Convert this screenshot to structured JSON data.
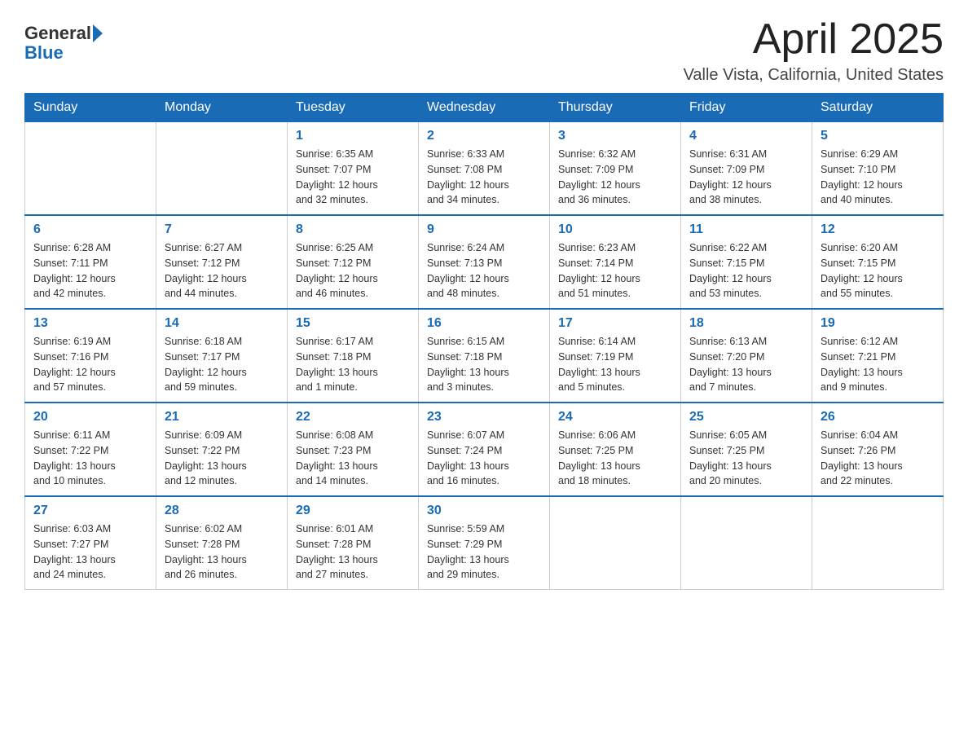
{
  "header": {
    "logo": {
      "general": "General",
      "blue": "Blue"
    },
    "title": "April 2025",
    "location": "Valle Vista, California, United States"
  },
  "calendar": {
    "weekdays": [
      "Sunday",
      "Monday",
      "Tuesday",
      "Wednesday",
      "Thursday",
      "Friday",
      "Saturday"
    ],
    "weeks": [
      [
        {
          "day": "",
          "info": ""
        },
        {
          "day": "",
          "info": ""
        },
        {
          "day": "1",
          "info": "Sunrise: 6:35 AM\nSunset: 7:07 PM\nDaylight: 12 hours\nand 32 minutes."
        },
        {
          "day": "2",
          "info": "Sunrise: 6:33 AM\nSunset: 7:08 PM\nDaylight: 12 hours\nand 34 minutes."
        },
        {
          "day": "3",
          "info": "Sunrise: 6:32 AM\nSunset: 7:09 PM\nDaylight: 12 hours\nand 36 minutes."
        },
        {
          "day": "4",
          "info": "Sunrise: 6:31 AM\nSunset: 7:09 PM\nDaylight: 12 hours\nand 38 minutes."
        },
        {
          "day": "5",
          "info": "Sunrise: 6:29 AM\nSunset: 7:10 PM\nDaylight: 12 hours\nand 40 minutes."
        }
      ],
      [
        {
          "day": "6",
          "info": "Sunrise: 6:28 AM\nSunset: 7:11 PM\nDaylight: 12 hours\nand 42 minutes."
        },
        {
          "day": "7",
          "info": "Sunrise: 6:27 AM\nSunset: 7:12 PM\nDaylight: 12 hours\nand 44 minutes."
        },
        {
          "day": "8",
          "info": "Sunrise: 6:25 AM\nSunset: 7:12 PM\nDaylight: 12 hours\nand 46 minutes."
        },
        {
          "day": "9",
          "info": "Sunrise: 6:24 AM\nSunset: 7:13 PM\nDaylight: 12 hours\nand 48 minutes."
        },
        {
          "day": "10",
          "info": "Sunrise: 6:23 AM\nSunset: 7:14 PM\nDaylight: 12 hours\nand 51 minutes."
        },
        {
          "day": "11",
          "info": "Sunrise: 6:22 AM\nSunset: 7:15 PM\nDaylight: 12 hours\nand 53 minutes."
        },
        {
          "day": "12",
          "info": "Sunrise: 6:20 AM\nSunset: 7:15 PM\nDaylight: 12 hours\nand 55 minutes."
        }
      ],
      [
        {
          "day": "13",
          "info": "Sunrise: 6:19 AM\nSunset: 7:16 PM\nDaylight: 12 hours\nand 57 minutes."
        },
        {
          "day": "14",
          "info": "Sunrise: 6:18 AM\nSunset: 7:17 PM\nDaylight: 12 hours\nand 59 minutes."
        },
        {
          "day": "15",
          "info": "Sunrise: 6:17 AM\nSunset: 7:18 PM\nDaylight: 13 hours\nand 1 minute."
        },
        {
          "day": "16",
          "info": "Sunrise: 6:15 AM\nSunset: 7:18 PM\nDaylight: 13 hours\nand 3 minutes."
        },
        {
          "day": "17",
          "info": "Sunrise: 6:14 AM\nSunset: 7:19 PM\nDaylight: 13 hours\nand 5 minutes."
        },
        {
          "day": "18",
          "info": "Sunrise: 6:13 AM\nSunset: 7:20 PM\nDaylight: 13 hours\nand 7 minutes."
        },
        {
          "day": "19",
          "info": "Sunrise: 6:12 AM\nSunset: 7:21 PM\nDaylight: 13 hours\nand 9 minutes."
        }
      ],
      [
        {
          "day": "20",
          "info": "Sunrise: 6:11 AM\nSunset: 7:22 PM\nDaylight: 13 hours\nand 10 minutes."
        },
        {
          "day": "21",
          "info": "Sunrise: 6:09 AM\nSunset: 7:22 PM\nDaylight: 13 hours\nand 12 minutes."
        },
        {
          "day": "22",
          "info": "Sunrise: 6:08 AM\nSunset: 7:23 PM\nDaylight: 13 hours\nand 14 minutes."
        },
        {
          "day": "23",
          "info": "Sunrise: 6:07 AM\nSunset: 7:24 PM\nDaylight: 13 hours\nand 16 minutes."
        },
        {
          "day": "24",
          "info": "Sunrise: 6:06 AM\nSunset: 7:25 PM\nDaylight: 13 hours\nand 18 minutes."
        },
        {
          "day": "25",
          "info": "Sunrise: 6:05 AM\nSunset: 7:25 PM\nDaylight: 13 hours\nand 20 minutes."
        },
        {
          "day": "26",
          "info": "Sunrise: 6:04 AM\nSunset: 7:26 PM\nDaylight: 13 hours\nand 22 minutes."
        }
      ],
      [
        {
          "day": "27",
          "info": "Sunrise: 6:03 AM\nSunset: 7:27 PM\nDaylight: 13 hours\nand 24 minutes."
        },
        {
          "day": "28",
          "info": "Sunrise: 6:02 AM\nSunset: 7:28 PM\nDaylight: 13 hours\nand 26 minutes."
        },
        {
          "day": "29",
          "info": "Sunrise: 6:01 AM\nSunset: 7:28 PM\nDaylight: 13 hours\nand 27 minutes."
        },
        {
          "day": "30",
          "info": "Sunrise: 5:59 AM\nSunset: 7:29 PM\nDaylight: 13 hours\nand 29 minutes."
        },
        {
          "day": "",
          "info": ""
        },
        {
          "day": "",
          "info": ""
        },
        {
          "day": "",
          "info": ""
        }
      ]
    ]
  }
}
